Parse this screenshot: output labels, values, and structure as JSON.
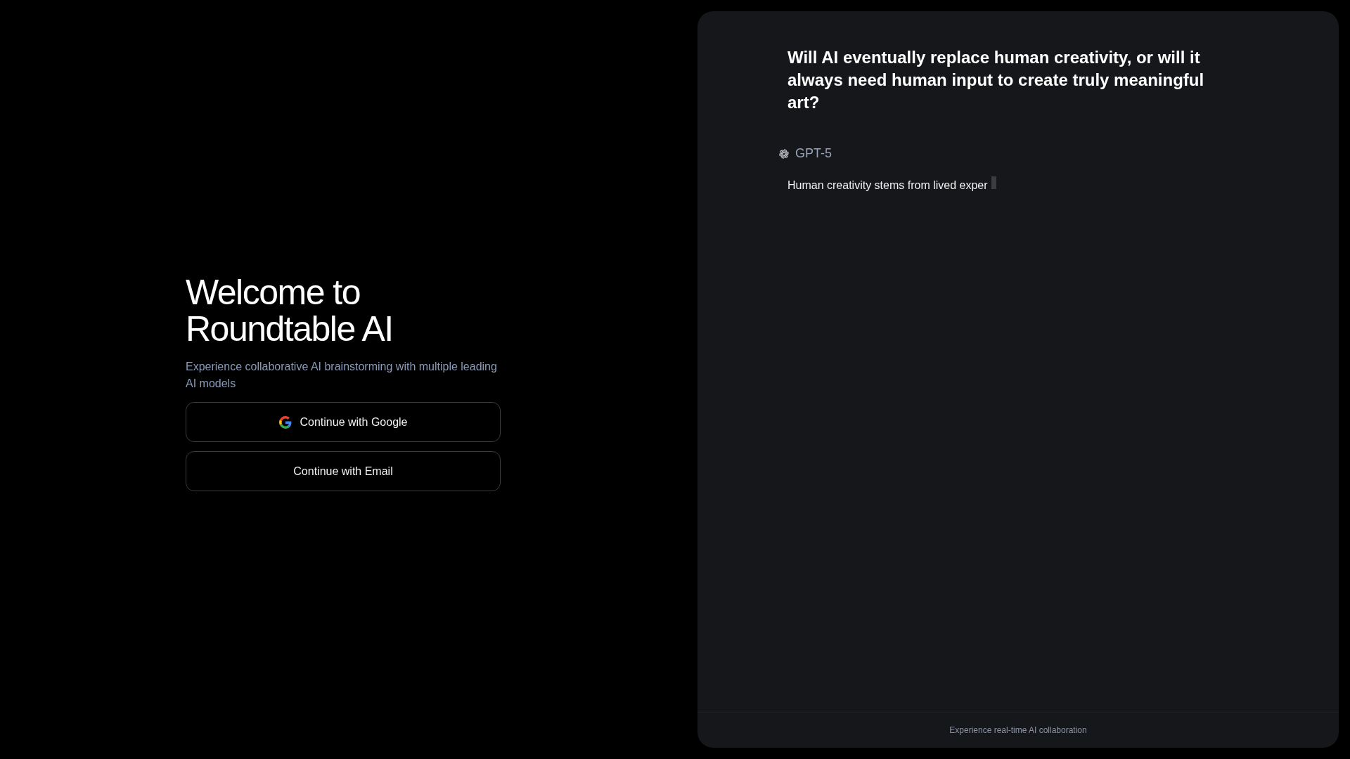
{
  "welcome": {
    "title_lines": [
      "Welcome to",
      "Roundtable AI"
    ],
    "subtitle": "Experience collaborative AI brainstorming with multiple leading AI models",
    "buttons": [
      {
        "kind": "google",
        "label": "Continue with Google"
      },
      {
        "kind": "email",
        "label": "Continue with Email"
      }
    ]
  },
  "preview": {
    "question": "Will AI eventually replace human creativity, or will it always need human input to create truly meaningful art?",
    "model": "GPT-5",
    "response": "Human creativity stems from lived exper",
    "typing": true,
    "footer": "Experience real-time AI collaboration"
  }
}
